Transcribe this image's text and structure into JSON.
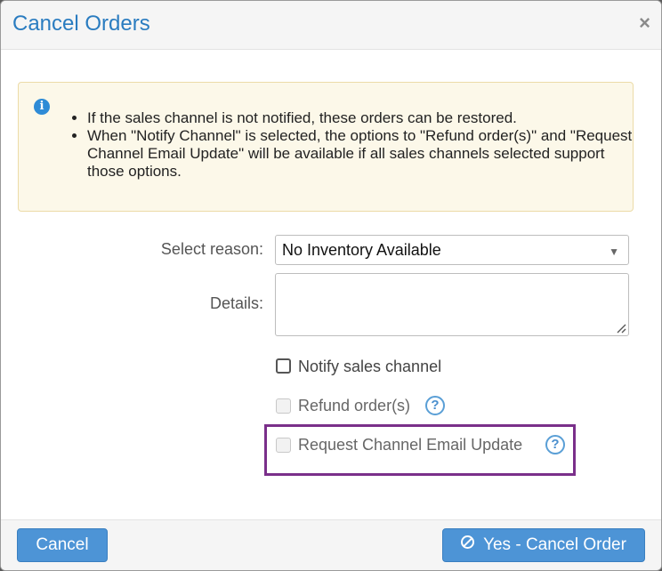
{
  "dialog": {
    "title": "Cancel Orders",
    "close_label": "×"
  },
  "alert": {
    "icon_glyph": "i",
    "items": [
      "If the sales channel is not notified, these orders can be restored.",
      "When \"Notify Channel\" is selected, the options to \"Refund order(s)\" and \"Request Channel Email Update\" will be available if all sales channels selected support those options."
    ]
  },
  "form": {
    "reason_label": "Select reason:",
    "reason_value": "No Inventory Available",
    "details_label": "Details:",
    "details_value": "",
    "notify_label": "Notify sales channel",
    "notify_checked": false,
    "refund_label": "Refund order(s)",
    "refund_disabled": true,
    "email_label": "Request Channel Email Update",
    "email_disabled": true,
    "help_glyph": "?"
  },
  "footer": {
    "cancel_label": "Cancel",
    "confirm_label": "Yes - Cancel Order"
  },
  "icons": {
    "info": "info-icon",
    "close": "close-icon",
    "help": "question-circle-icon",
    "ban": "ban-icon",
    "dropdown": "caret-down-icon"
  },
  "colors": {
    "title": "#2a7cc0",
    "primary_button": "#4d94d6",
    "alert_bg": "#fcf8e9",
    "highlight": "#7a2f8a"
  }
}
